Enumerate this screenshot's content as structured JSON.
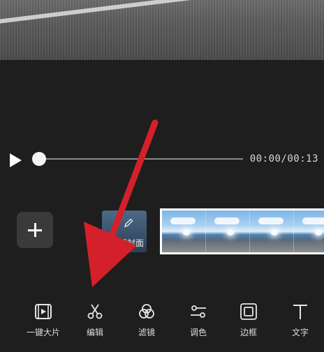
{
  "player": {
    "time": "00:00/00:13",
    "progress": 0.0
  },
  "timeline": {
    "cover_label": "设置封面"
  },
  "toolbar": {
    "tools": [
      {
        "label": "一键大片",
        "icon": "film-sparkle-icon"
      },
      {
        "label": "编辑",
        "icon": "scissors-icon"
      },
      {
        "label": "滤镜",
        "icon": "filter-circles-icon"
      },
      {
        "label": "调色",
        "icon": "adjust-sliders-icon"
      },
      {
        "label": "边框",
        "icon": "frame-border-icon"
      },
      {
        "label": "文字",
        "icon": "text-icon"
      }
    ]
  },
  "colors": {
    "background": "#1e1e1e",
    "annotation_arrow": "#d4202a",
    "text": "#dcdcdc"
  }
}
